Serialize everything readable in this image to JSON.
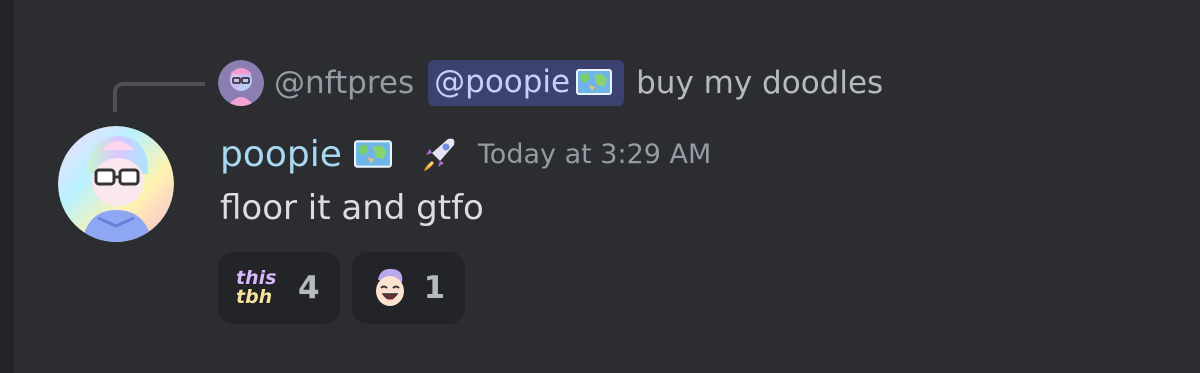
{
  "reply": {
    "author": "@nftpres",
    "mention": "@poopie",
    "text": "buy my doodles",
    "avatar_icon": "doodle-avatar-icon"
  },
  "message": {
    "username": "poopie",
    "timestamp": "Today at 3:29 AM",
    "content": "floor it and gtfo",
    "badges": [
      "map-badge-icon",
      "rocket-icon"
    ]
  },
  "reactions": [
    {
      "emoji_icon": "this-tbh-emoji-icon",
      "emoji_text_line1": "this",
      "emoji_text_line2": "tbh",
      "count": "4"
    },
    {
      "emoji_icon": "laughing-doodle-emoji-icon",
      "count": "1"
    }
  ],
  "colors": {
    "background": "#2b2d31",
    "username": "#a8d8f2",
    "mention_bg": "#3c4270",
    "mention_text": "#c9cdfb",
    "muted": "#949ba4",
    "reaction_bg": "#232428"
  }
}
